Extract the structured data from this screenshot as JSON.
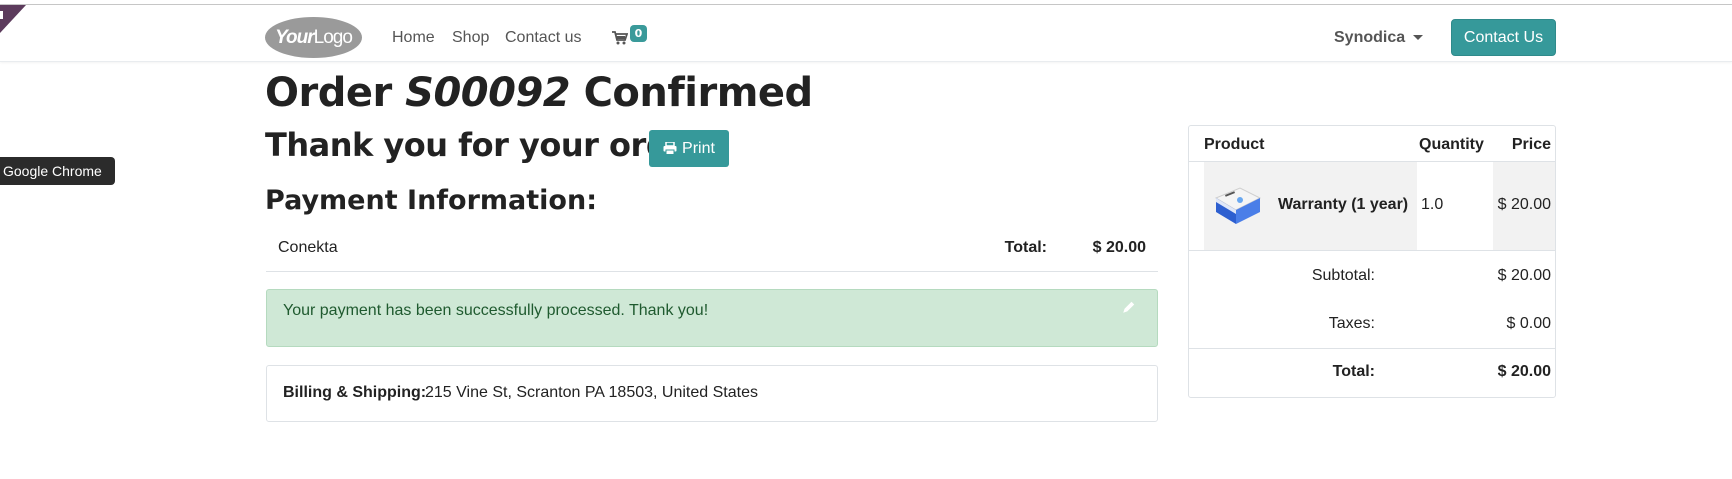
{
  "browser": {
    "tooltip": "Google Chrome"
  },
  "navbar": {
    "logo_text_bold": "Your",
    "logo_text_light": "Logo",
    "links": [
      "Home",
      "Shop",
      "Contact us"
    ],
    "cart_count": "0",
    "user_name": "Synodica",
    "contact_button": "Contact Us"
  },
  "order": {
    "title_prefix": "Order",
    "order_number": "S00092",
    "title_suffix": "Confirmed",
    "thank_you": "Thank you for your order.",
    "print_label": "Print"
  },
  "payment": {
    "heading": "Payment Information:",
    "method": "Conekta",
    "total_label": "Total:",
    "total_value": "$ 20.00",
    "success_message": "Your payment has been successfully processed. Thank you!"
  },
  "billing": {
    "label": "Billing & Shipping:",
    "address": "215 Vine St, Scranton PA 18503, United States"
  },
  "summary": {
    "headers": {
      "product": "Product",
      "quantity": "Quantity",
      "price": "Price"
    },
    "items": [
      {
        "name": "Warranty (1 year)",
        "quantity": "1.0",
        "price": "$ 20.00"
      }
    ],
    "subtotal_label": "Subtotal:",
    "subtotal_value": "$ 20.00",
    "taxes_label": "Taxes:",
    "taxes_value": "$ 0.00",
    "total_label": "Total:",
    "total_value": "$ 20.00"
  },
  "colors": {
    "accent": "#36999a",
    "success_bg": "#cfe8d6",
    "success_text": "#1f5a2f",
    "ribbon": "#5c3b5c"
  }
}
